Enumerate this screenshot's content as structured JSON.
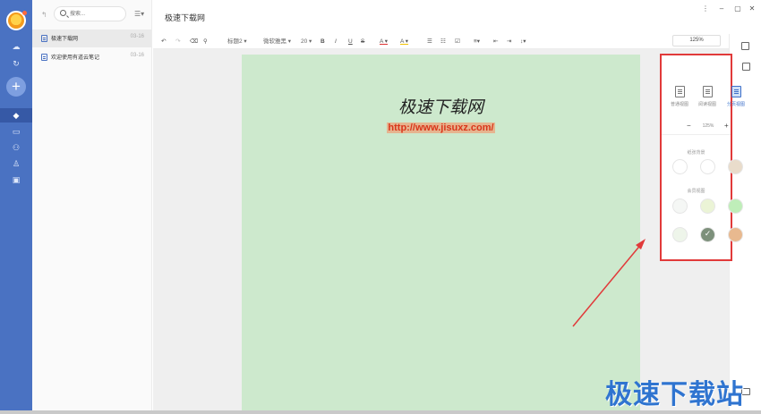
{
  "app": {
    "window_controls": {
      "more": "⋮",
      "minimize": "–",
      "maximize": "▢",
      "close": "✕"
    }
  },
  "sidebar": {
    "icons": [
      "avatar",
      "cloud-sync-icon",
      "refresh-icon",
      "add-icon",
      "notebook-icon",
      "bookmark-icon",
      "share-icon",
      "group-icon",
      "trash-icon"
    ],
    "active": "notebook-icon",
    "add_label": "+"
  },
  "note_list": {
    "search_placeholder": "搜索...",
    "notes": [
      {
        "title": "极速下载网",
        "date": "03-16",
        "active": true
      },
      {
        "title": "欢迎使用有道云笔记",
        "date": "03-16",
        "active": false
      }
    ]
  },
  "editor": {
    "title": "极速下载网",
    "toolbar": {
      "heading": "标题2",
      "font": "微软雅黑",
      "size": "20",
      "bold": "B",
      "italic": "I",
      "underline": "U",
      "strike": "S",
      "font_color": "A",
      "highlight": "A",
      "zoom": "125%"
    },
    "page": {
      "background": "#cde9cd",
      "heading": "极速下载网",
      "url": "http://www.jisuxz.com/"
    }
  },
  "view_panel": {
    "views": [
      {
        "label": "普通视图",
        "active": false
      },
      {
        "label": "阅读视图",
        "active": false
      },
      {
        "label": "分页视图",
        "active": true
      }
    ],
    "zoom_minus": "−",
    "zoom_value": "125%",
    "zoom_plus": "+",
    "paper_background_label": "纸张背景",
    "paper_backgrounds": [
      "#ffffff",
      "#ffffff",
      "#e9dccb"
    ],
    "member_background_label": "会员视图",
    "member_backgrounds": [
      "#f5f7f5",
      "#ebf4d6",
      "#bfeeb9",
      "#eef5ea",
      "#7d907b",
      "#e8b98f"
    ],
    "selected_member_background": 4
  },
  "watermark": "极速下载站"
}
